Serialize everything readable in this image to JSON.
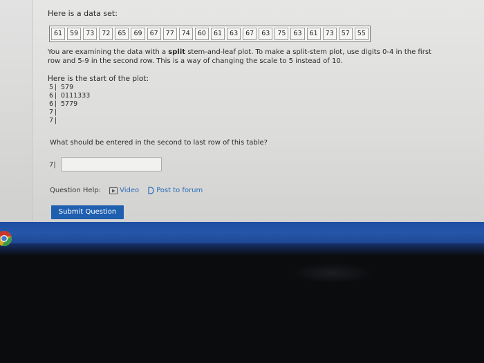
{
  "intro": {
    "text": "Here is a data set:"
  },
  "dataset": [
    "61",
    "59",
    "73",
    "72",
    "65",
    "69",
    "67",
    "77",
    "74",
    "60",
    "61",
    "63",
    "67",
    "63",
    "75",
    "63",
    "61",
    "73",
    "57",
    "55"
  ],
  "instructions": {
    "part1": "You are examining the data with a ",
    "bold": "split",
    "part2": " stem-and-leaf plot. To make a split-stem plot, use digits 0-4 in the first row and 5-9 in the second row. This is a way of changing the scale to 5 instead of 10."
  },
  "plot": {
    "heading": "Here is the start of the plot:",
    "rows": [
      {
        "stem": "5",
        "sep": "|",
        "leaves": "579"
      },
      {
        "stem": "6",
        "sep": "|",
        "leaves": "0111333"
      },
      {
        "stem": "6",
        "sep": "|",
        "leaves": "5779"
      },
      {
        "stem": "7",
        "sep": "|",
        "leaves": ""
      },
      {
        "stem": "7",
        "sep": "|",
        "leaves": ""
      }
    ]
  },
  "question": {
    "text": "What should be entered in the second to last row of this table?"
  },
  "answer": {
    "label": "7|",
    "value": ""
  },
  "help": {
    "label": "Question Help:",
    "video": "Video",
    "forum": "Post to forum"
  },
  "submit": {
    "label": "Submit Question"
  },
  "colors": {
    "link": "#2a6db7",
    "button": "#1f5fb0",
    "taskbar": "#2556a8"
  },
  "icons": {
    "video": "play-video-icon",
    "forum": "forum-post-icon",
    "taskbar": "chrome-browser-icon"
  }
}
